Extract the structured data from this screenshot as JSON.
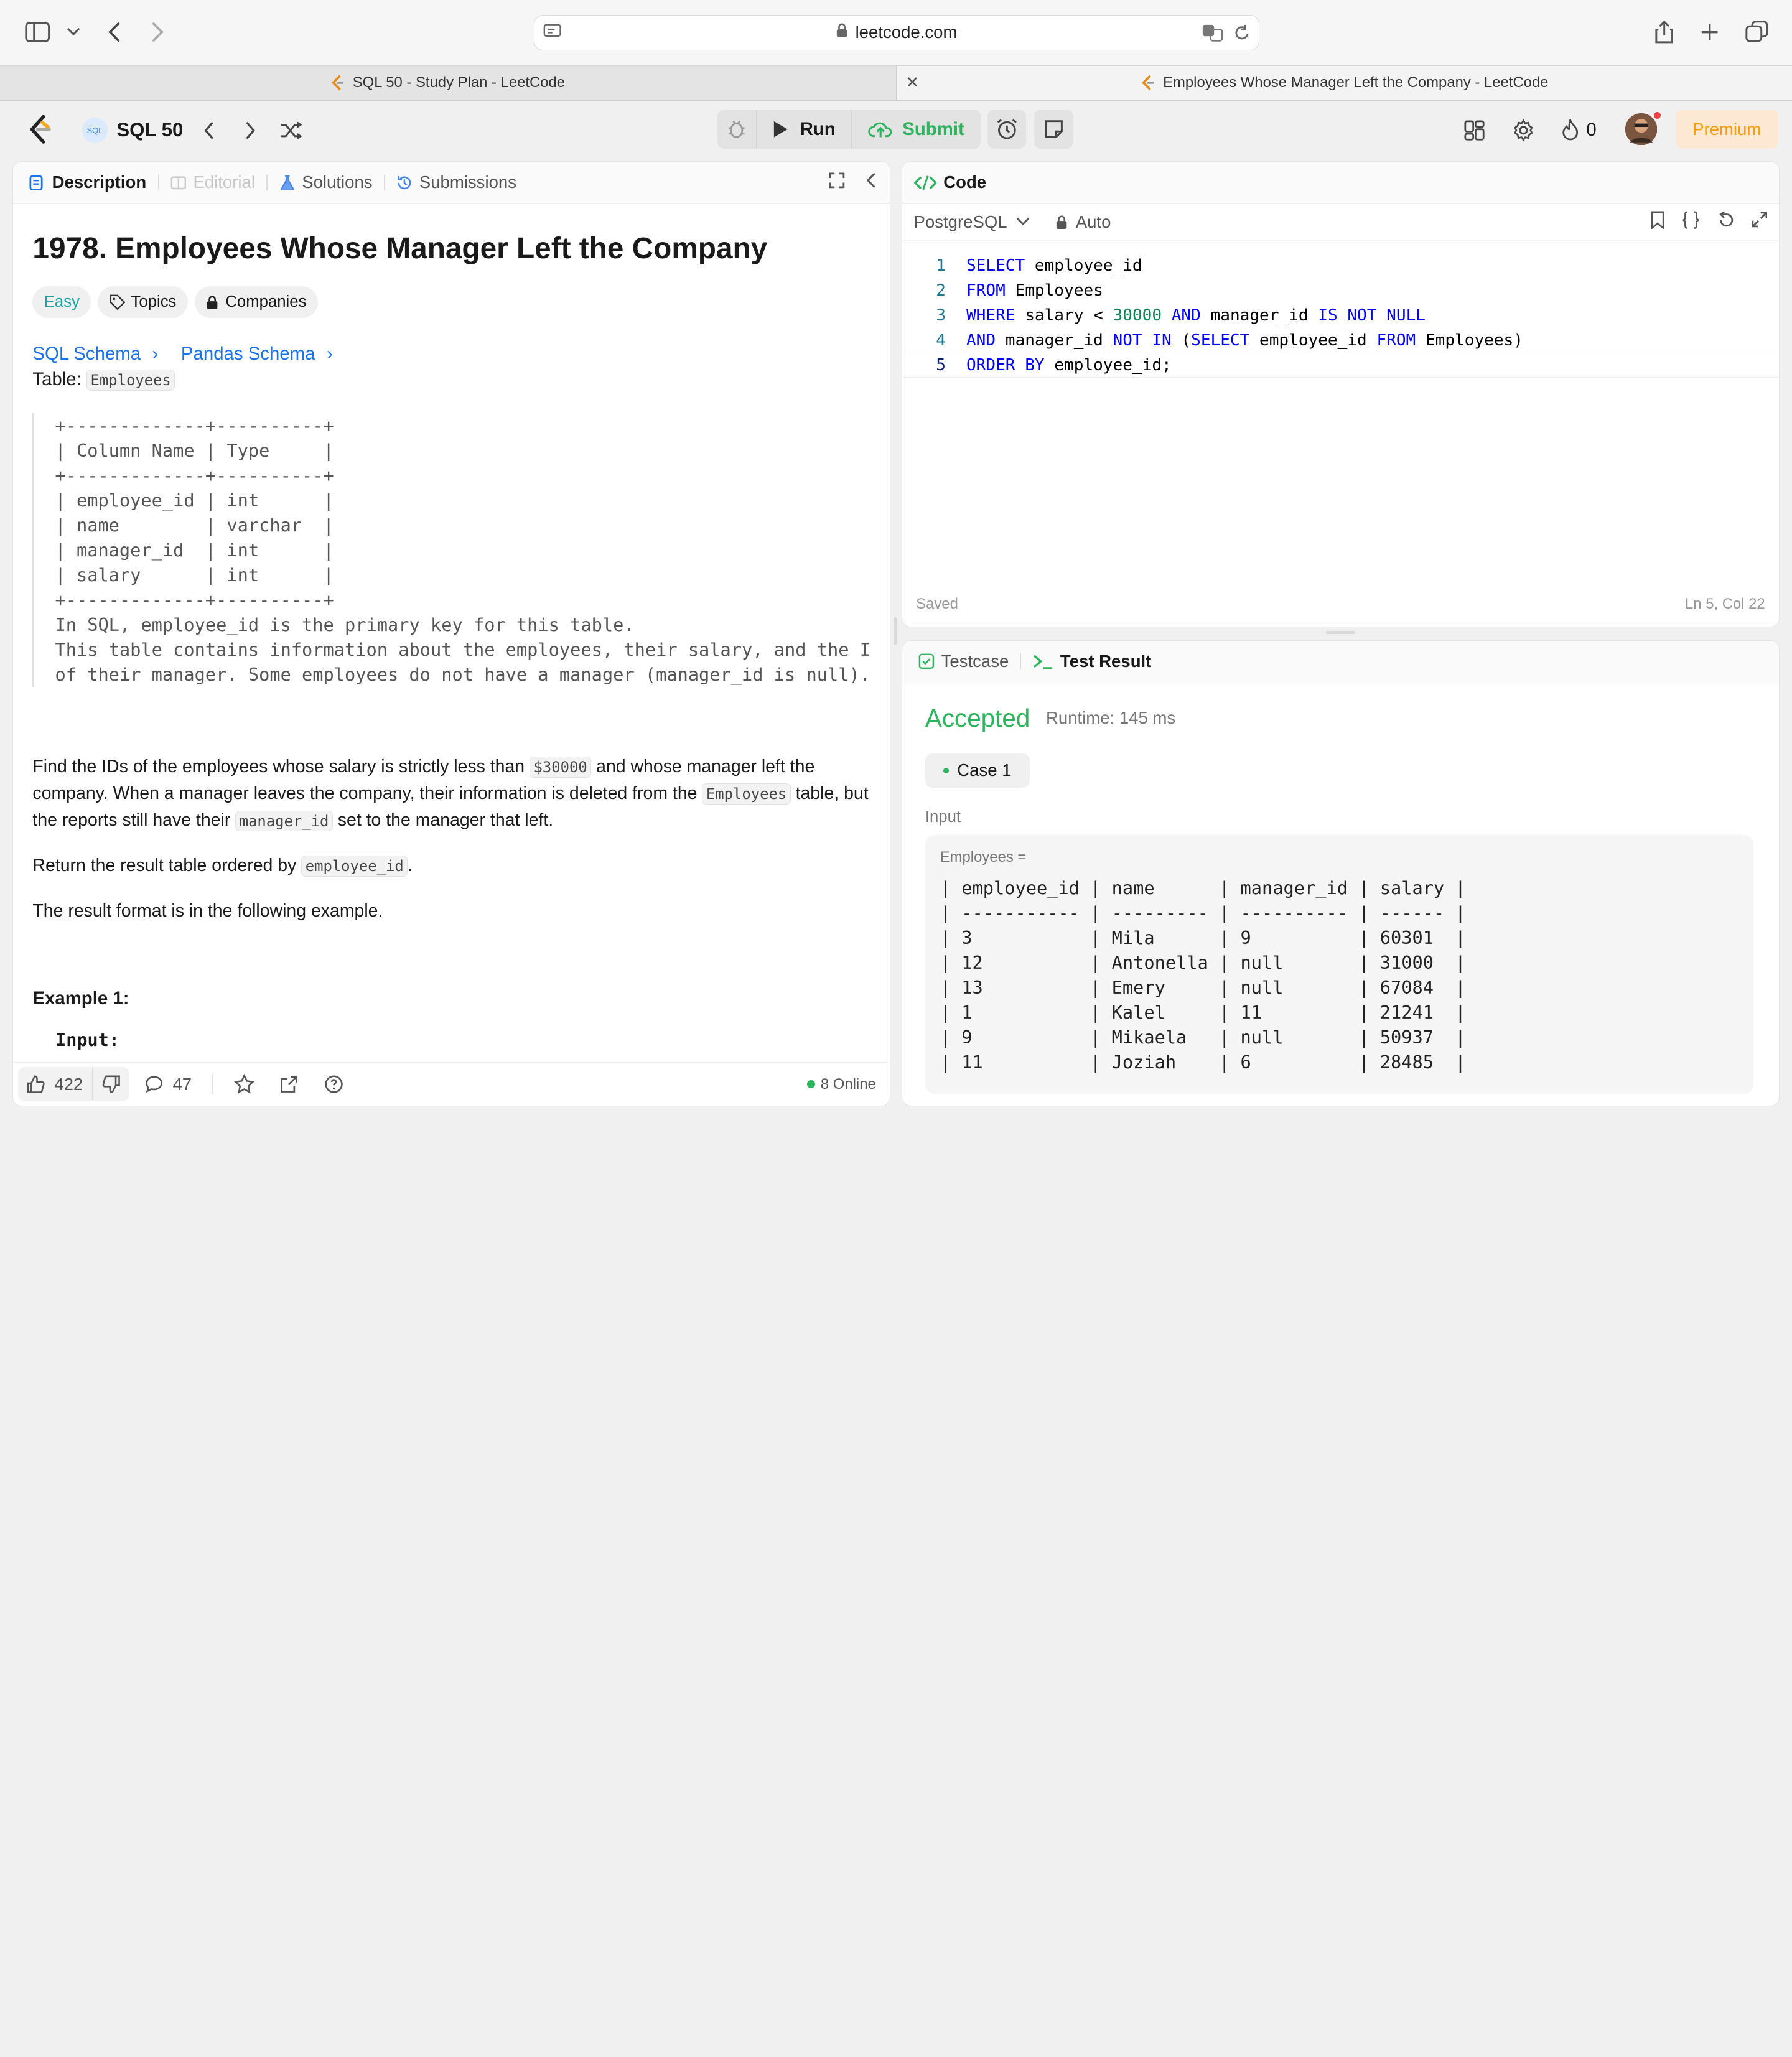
{
  "browser": {
    "url": "leetcode.com",
    "tabs": [
      {
        "title": "SQL 50 - Study Plan - LeetCode",
        "active": false
      },
      {
        "title": "Employees Whose Manager Left the Company - LeetCode",
        "active": true
      }
    ]
  },
  "nav": {
    "study_plan": "SQL 50",
    "run_label": "Run",
    "submit_label": "Submit",
    "streak_count": "0",
    "premium_label": "Premium"
  },
  "left_tabs": {
    "description": "Description",
    "editorial": "Editorial",
    "solutions": "Solutions",
    "submissions": "Submissions"
  },
  "problem": {
    "title": "1978. Employees Whose Manager Left the Company",
    "difficulty": "Easy",
    "topics_label": "Topics",
    "companies_label": "Companies",
    "sql_schema_link": "SQL Schema",
    "pandas_schema_link": "Pandas Schema",
    "table_label": "Table:",
    "table_name": "Employees",
    "schema_text": "+-------------+----------+\n| Column Name | Type     |\n+-------------+----------+\n| employee_id | int      |\n| name        | varchar  |\n| manager_id  | int      |\n| salary      | int      |\n+-------------+----------+\nIn SQL, employee_id is the primary key for this table.\nThis table contains information about the employees, their salary, and the ID\nof their manager. Some employees do not have a manager (manager_id is null).",
    "para1_a": "Find the IDs of the employees whose salary is strictly less than ",
    "para1_code1": "$30000",
    "para1_b": " and whose manager left the company. When a manager leaves the company, their information is deleted from the ",
    "para1_code2": "Employees",
    "para1_c": " table, but the reports still have their ",
    "para1_code3": "manager_id",
    "para1_d": " set to the manager that left.",
    "para2_a": "Return the result table ordered by ",
    "para2_code": "employee_id",
    "para2_b": ".",
    "para3": "The result format is in the following example.",
    "example_heading": "Example 1:",
    "input_heading": "Input:"
  },
  "bottom_bar": {
    "likes": "422",
    "comments": "47",
    "online": "8 Online"
  },
  "code_panel": {
    "title": "Code",
    "language": "PostgreSQL",
    "mode": "Auto",
    "status": "Saved",
    "cursor_position": "Ln 5, Col 22",
    "line_numbers": [
      "1",
      "2",
      "3",
      "4",
      "5"
    ]
  },
  "result_panel": {
    "testcase_tab": "Testcase",
    "result_tab": "Test Result",
    "verdict": "Accepted",
    "runtime": "Runtime: 145 ms",
    "case_label": "Case 1",
    "input_label": "Input",
    "var_label": "Employees =",
    "input_table": "| employee_id | name      | manager_id | salary |\n| ----------- | --------- | ---------- | ------ |\n| 3           | Mila      | 9          | 60301  |\n| 12          | Antonella | null       | 31000  |\n| 13          | Emery     | null       | 67084  |\n| 1           | Kalel     | 11         | 21241  |\n| 9           | Mikaela   | null       | 50937  |\n| 11          | Joziah    | 6          | 28485  |"
  },
  "colors": {
    "accent_green": "#2db55d",
    "link_blue": "#1a73e8",
    "easy_teal": "#1ca3a3",
    "premium_orange": "#f59e0b"
  }
}
